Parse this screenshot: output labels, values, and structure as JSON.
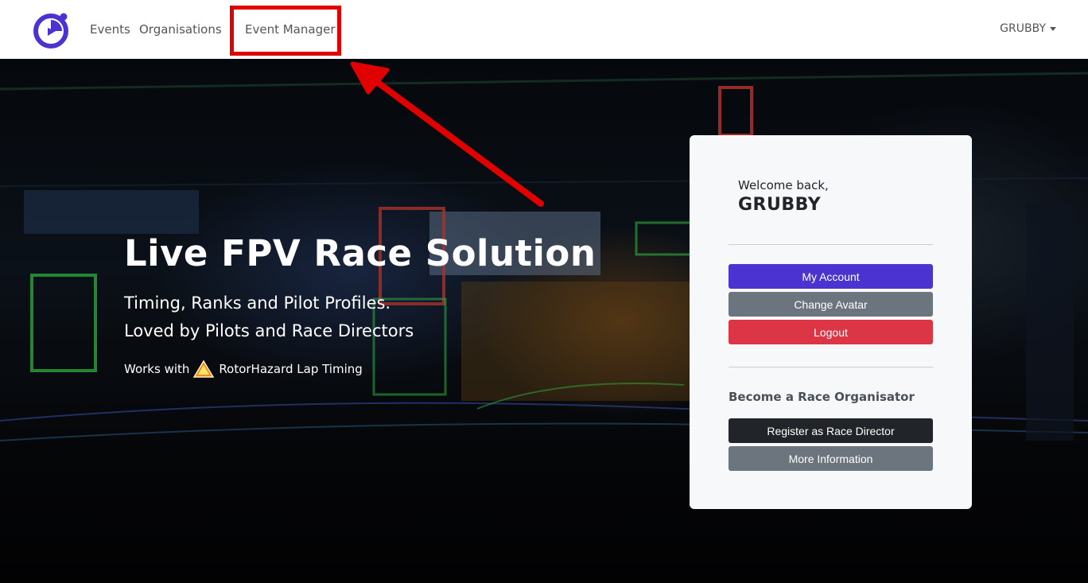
{
  "nav": {
    "links": [
      "Events",
      "Organisations",
      "Event Manager"
    ],
    "user": "GRUBBY"
  },
  "hero": {
    "title": "Live FPV Race Solution",
    "subtitle_1": "Timing, Ranks and Pilot Profiles.",
    "subtitle_2": "Loved by Pilots and Race Directors",
    "works_with": "Works with",
    "timing_system": "RotorHazard Lap Timing"
  },
  "card": {
    "welcome": "Welcome back,",
    "username": "GRUBBY",
    "buttons": {
      "my_account": "My Account",
      "change_avatar": "Change Avatar",
      "logout": "Logout",
      "register": "Register as Race Director",
      "more_info": "More Information"
    },
    "org_heading": "Become a Race Organisator"
  },
  "colors": {
    "brand": "#4a33d1",
    "danger": "#dc3545",
    "secondary": "#6c757d",
    "dark": "#212529",
    "annotation": "#e00000"
  },
  "icons": {
    "logo": "stopwatch-logo-icon",
    "rotorhazard": "rotorhazard-warning-icon",
    "user_caret": "caret-down-icon"
  }
}
